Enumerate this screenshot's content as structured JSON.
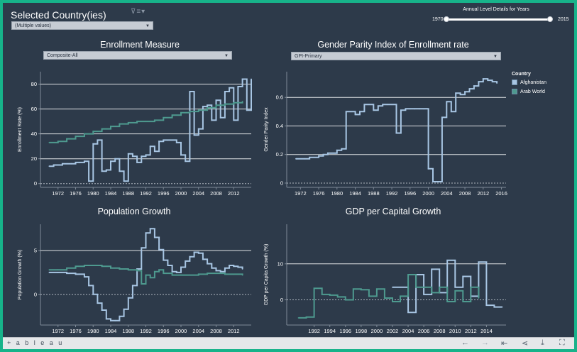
{
  "header": {
    "title": "Selected Country(ies)",
    "title_controls": "⊽≡▾",
    "country_select_value": "(Multiple values)"
  },
  "slider": {
    "title": "Annual Level Details for Years",
    "start": "1970",
    "end": "2015"
  },
  "legend": {
    "title": "Country",
    "items": [
      {
        "label": "Afghanistan",
        "color": "#a8c6e4"
      },
      {
        "label": "Arab World",
        "color": "#4e9a8f"
      }
    ]
  },
  "toolbar": {
    "brand": "+ a b l e a u",
    "icons": [
      "undo-icon",
      "redo-icon",
      "revert-icon",
      "share-icon",
      "download-icon",
      "fullscreen-icon"
    ]
  },
  "colors": {
    "afghanistan": "#a8c6e4",
    "arab_world": "#4e9a8f",
    "background": "#2d3a4a",
    "gridline": "#ffffff"
  },
  "chart_data": [
    {
      "id": "enrollment",
      "type": "line",
      "step": true,
      "title": "Enrollment Measure",
      "dropdown": "Composite-All",
      "xlabel": "",
      "ylabel": "Enrollment Rate (%)",
      "xlim": [
        1968,
        2016
      ],
      "ylim": [
        -3,
        90
      ],
      "xticks": [
        1972,
        1976,
        1980,
        1984,
        1988,
        1992,
        1996,
        2000,
        2004,
        2008,
        2012
      ],
      "yticks": [
        0,
        20,
        40,
        60,
        80
      ],
      "grid": true,
      "series": [
        {
          "name": "Afghanistan",
          "color": "#a8c6e4",
          "points": [
            [
              1970,
              14
            ],
            [
              1971,
              15
            ],
            [
              1972,
              15
            ],
            [
              1973,
              16
            ],
            [
              1974,
              16
            ],
            [
              1975,
              16
            ],
            [
              1976,
              17
            ],
            [
              1977,
              17
            ],
            [
              1978,
              18
            ],
            [
              1979,
              2
            ],
            [
              1980,
              32
            ],
            [
              1981,
              35
            ],
            [
              1982,
              10
            ],
            [
              1983,
              11
            ],
            [
              1984,
              18
            ],
            [
              1985,
              20
            ],
            [
              1986,
              10
            ],
            [
              1987,
              2
            ],
            [
              1988,
              24
            ],
            [
              1989,
              22
            ],
            [
              1990,
              17
            ],
            [
              1991,
              22
            ],
            [
              1992,
              23
            ],
            [
              1993,
              30
            ],
            [
              1994,
              26
            ],
            [
              1995,
              34
            ],
            [
              1996,
              35
            ],
            [
              1997,
              35
            ],
            [
              1998,
              35
            ],
            [
              1999,
              33
            ],
            [
              2000,
              23
            ],
            [
              2001,
              18
            ],
            [
              2002,
              74
            ],
            [
              2003,
              39
            ],
            [
              2004,
              44
            ],
            [
              2005,
              62
            ],
            [
              2006,
              63
            ],
            [
              2007,
              51
            ],
            [
              2008,
              67
            ],
            [
              2009,
              53
            ],
            [
              2010,
              74
            ],
            [
              2011,
              77
            ],
            [
              2012,
              51
            ],
            [
              2013,
              78
            ],
            [
              2014,
              84
            ],
            [
              2015,
              59
            ],
            [
              2016,
              84
            ]
          ]
        },
        {
          "name": "Arab World",
          "color": "#4e9a8f",
          "points": [
            [
              1970,
              33
            ],
            [
              1972,
              34
            ],
            [
              1974,
              36
            ],
            [
              1976,
              38
            ],
            [
              1978,
              40
            ],
            [
              1980,
              42
            ],
            [
              1982,
              44
            ],
            [
              1984,
              46
            ],
            [
              1986,
              48
            ],
            [
              1988,
              49
            ],
            [
              1990,
              50
            ],
            [
              1992,
              50
            ],
            [
              1994,
              51
            ],
            [
              1996,
              53
            ],
            [
              1998,
              55
            ],
            [
              2000,
              57
            ],
            [
              2002,
              58
            ],
            [
              2004,
              59
            ],
            [
              2006,
              61
            ],
            [
              2008,
              63
            ],
            [
              2010,
              64
            ],
            [
              2012,
              65
            ],
            [
              2014,
              66
            ]
          ]
        }
      ]
    },
    {
      "id": "gpi",
      "type": "line",
      "step": true,
      "title": "Gender Parity Index of Enrollment rate",
      "dropdown": "GPI-Primary",
      "xlabel": "",
      "ylabel": "Gender Parity Index",
      "xlim": [
        1969,
        2017
      ],
      "ylim": [
        -0.03,
        0.78
      ],
      "xticks": [
        1972,
        1976,
        1980,
        1984,
        1988,
        1992,
        1996,
        2000,
        2004,
        2008,
        2012,
        2016
      ],
      "yticks": [
        0.0,
        0.2,
        0.4,
        0.6
      ],
      "grid": true,
      "series": [
        {
          "name": "Afghanistan",
          "color": "#a8c6e4",
          "points": [
            [
              1971,
              0.17
            ],
            [
              1973,
              0.17
            ],
            [
              1974,
              0.18
            ],
            [
              1976,
              0.19
            ],
            [
              1977,
              0.2
            ],
            [
              1978,
              0.21
            ],
            [
              1980,
              0.23
            ],
            [
              1981,
              0.24
            ],
            [
              1982,
              0.5
            ],
            [
              1983,
              0.5
            ],
            [
              1984,
              0.48
            ],
            [
              1985,
              0.5
            ],
            [
              1986,
              0.55
            ],
            [
              1987,
              0.55
            ],
            [
              1988,
              0.51
            ],
            [
              1989,
              0.54
            ],
            [
              1990,
              0.55
            ],
            [
              1991,
              0.55
            ],
            [
              1992,
              0.55
            ],
            [
              1993,
              0.35
            ],
            [
              1994,
              0.51
            ],
            [
              1995,
              0.52
            ],
            [
              1996,
              0.52
            ],
            [
              1997,
              0.52
            ],
            [
              1998,
              0.52
            ],
            [
              1999,
              0.52
            ],
            [
              2000,
              0.1
            ],
            [
              2001,
              0.01
            ],
            [
              2002,
              0.01
            ],
            [
              2003,
              0.46
            ],
            [
              2004,
              0.57
            ],
            [
              2005,
              0.5
            ],
            [
              2006,
              0.63
            ],
            [
              2007,
              0.62
            ],
            [
              2008,
              0.64
            ],
            [
              2009,
              0.66
            ],
            [
              2010,
              0.68
            ],
            [
              2011,
              0.71
            ],
            [
              2012,
              0.73
            ],
            [
              2013,
              0.72
            ],
            [
              2014,
              0.71
            ],
            [
              2015,
              0.7
            ]
          ]
        }
      ]
    },
    {
      "id": "population",
      "type": "line",
      "step": true,
      "title": "Population Growth",
      "xlabel": "",
      "ylabel": "Population Growth (%)",
      "xlim": [
        1968,
        2016
      ],
      "ylim": [
        -3.5,
        8
      ],
      "xticks": [
        1972,
        1976,
        1980,
        1984,
        1988,
        1992,
        1996,
        2000,
        2004,
        2008,
        2012
      ],
      "yticks": [
        0,
        5
      ],
      "grid": true,
      "series": [
        {
          "name": "Afghanistan",
          "color": "#a8c6e4",
          "points": [
            [
              1970,
              2.5
            ],
            [
              1972,
              2.5
            ],
            [
              1974,
              2.4
            ],
            [
              1976,
              2.3
            ],
            [
              1978,
              2.0
            ],
            [
              1979,
              1.0
            ],
            [
              1980,
              0.0
            ],
            [
              1981,
              -1.0
            ],
            [
              1982,
              -1.8
            ],
            [
              1983,
              -2.8
            ],
            [
              1984,
              -3.0
            ],
            [
              1985,
              -3.0
            ],
            [
              1986,
              -2.5
            ],
            [
              1987,
              -1.7
            ],
            [
              1988,
              -0.4
            ],
            [
              1989,
              1.0
            ],
            [
              1990,
              2.9
            ],
            [
              1991,
              5.3
            ],
            [
              1992,
              7.0
            ],
            [
              1993,
              7.5
            ],
            [
              1994,
              6.5
            ],
            [
              1995,
              5.1
            ],
            [
              1996,
              3.9
            ],
            [
              1997,
              3.3
            ],
            [
              1998,
              2.6
            ],
            [
              1999,
              2.5
            ],
            [
              2000,
              3.1
            ],
            [
              2001,
              3.8
            ],
            [
              2002,
              4.3
            ],
            [
              2003,
              4.8
            ],
            [
              2004,
              4.7
            ],
            [
              2005,
              4.0
            ],
            [
              2006,
              3.5
            ],
            [
              2007,
              3.0
            ],
            [
              2008,
              2.7
            ],
            [
              2009,
              2.6
            ],
            [
              2010,
              3.0
            ],
            [
              2011,
              3.3
            ],
            [
              2012,
              3.2
            ],
            [
              2013,
              3.1
            ],
            [
              2014,
              2.9
            ]
          ]
        },
        {
          "name": "Arab World",
          "color": "#4e9a8f",
          "points": [
            [
              1970,
              2.8
            ],
            [
              1972,
              2.8
            ],
            [
              1974,
              3.0
            ],
            [
              1976,
              3.2
            ],
            [
              1978,
              3.3
            ],
            [
              1980,
              3.3
            ],
            [
              1982,
              3.2
            ],
            [
              1984,
              3.0
            ],
            [
              1986,
              2.9
            ],
            [
              1988,
              2.8
            ],
            [
              1990,
              2.7
            ],
            [
              1991,
              1.2
            ],
            [
              1992,
              2.2
            ],
            [
              1993,
              1.9
            ],
            [
              1994,
              2.6
            ],
            [
              1995,
              2.8
            ],
            [
              1996,
              2.4
            ],
            [
              1998,
              2.2
            ],
            [
              2000,
              2.2
            ],
            [
              2002,
              2.2
            ],
            [
              2004,
              2.3
            ],
            [
              2006,
              2.4
            ],
            [
              2008,
              2.4
            ],
            [
              2010,
              2.3
            ],
            [
              2012,
              2.3
            ],
            [
              2014,
              2.2
            ]
          ]
        }
      ]
    },
    {
      "id": "gdp",
      "type": "line",
      "step": true,
      "title": "GDP per Capital Growth",
      "xlabel": "",
      "ylabel": "GDP per Capita Growth (%)",
      "xlim": [
        1988.5,
        2016.5
      ],
      "ylim": [
        -7,
        21
      ],
      "xticks": [
        1992,
        1994,
        1996,
        1998,
        2000,
        2002,
        2004,
        2006,
        2008,
        2010,
        2012,
        2014
      ],
      "yticks": [
        0,
        10
      ],
      "grid": true,
      "series": [
        {
          "name": "Afghanistan",
          "color": "#a8c6e4",
          "points": [
            [
              2002,
              3.5
            ],
            [
              2003,
              3.5
            ],
            [
              2004,
              -3.5
            ],
            [
              2005,
              7
            ],
            [
              2006,
              1.5
            ],
            [
              2007,
              8.5
            ],
            [
              2008,
              2.0
            ],
            [
              2009,
              11
            ],
            [
              2010,
              3.5
            ],
            [
              2011,
              6.5
            ],
            [
              2012,
              1.0
            ],
            [
              2013,
              10.5
            ],
            [
              2014,
              -1.5
            ],
            [
              2015,
              -2.0
            ],
            [
              2016,
              -2.0
            ]
          ]
        },
        {
          "name": "Arab World",
          "color": "#4e9a8f",
          "points": [
            [
              1990,
              -5
            ],
            [
              1991,
              -4.8
            ],
            [
              1992,
              3.2
            ],
            [
              1993,
              1.5
            ],
            [
              1994,
              1.3
            ],
            [
              1995,
              0.8
            ],
            [
              1996,
              0.0
            ],
            [
              1997,
              3.0
            ],
            [
              1998,
              2.8
            ],
            [
              1999,
              1.0
            ],
            [
              2000,
              3.0
            ],
            [
              2001,
              0.5
            ],
            [
              2002,
              -0.5
            ],
            [
              2003,
              1.0
            ],
            [
              2004,
              7.0
            ],
            [
              2005,
              3.5
            ],
            [
              2006,
              3.5
            ],
            [
              2007,
              2.0
            ],
            [
              2008,
              3.5
            ],
            [
              2009,
              -0.5
            ],
            [
              2010,
              2.5
            ],
            [
              2011,
              -0.5
            ],
            [
              2012,
              3.5
            ],
            [
              2013,
              0.5
            ]
          ]
        }
      ]
    }
  ]
}
